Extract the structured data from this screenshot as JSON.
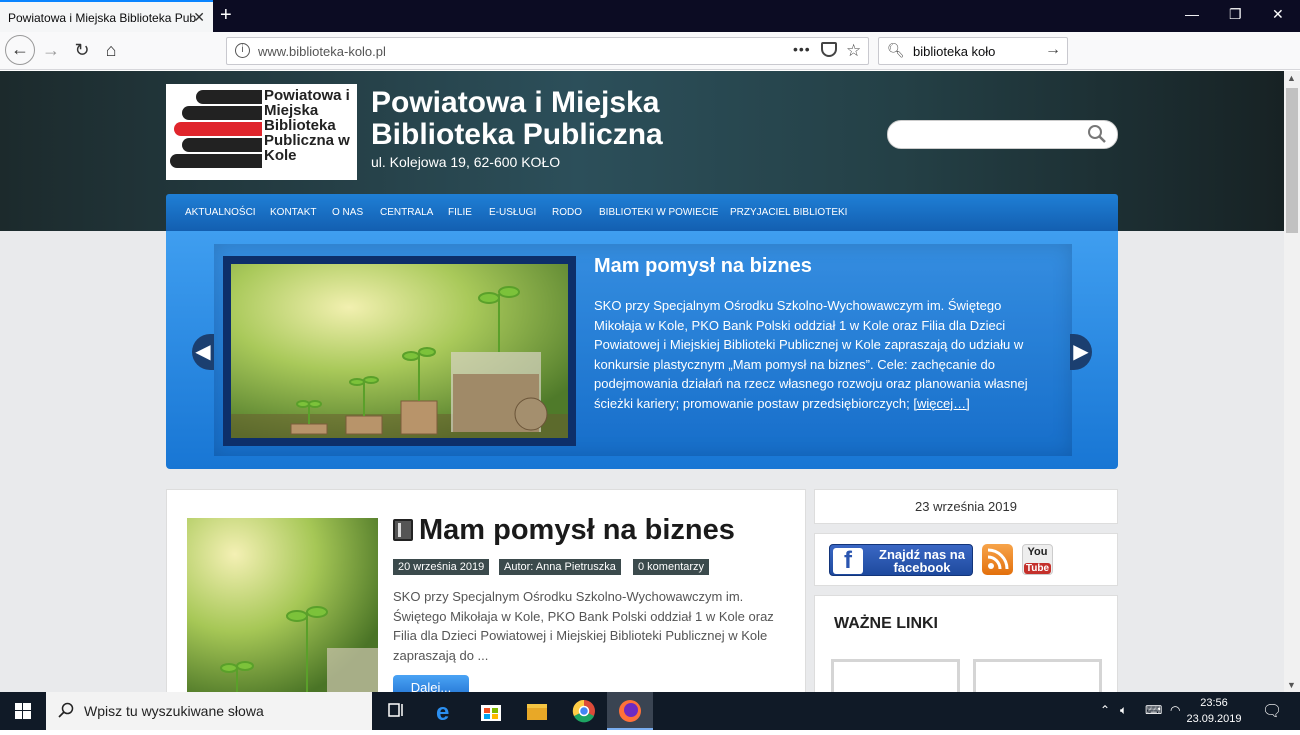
{
  "browser": {
    "tab_title": "Powiatowa i Miejska Biblioteka Pub",
    "url": "www.biblioteka-kolo.pl",
    "search_value": "biblioteka koło"
  },
  "site": {
    "logo_text": "Powiatowa i Miejska Biblioteka Publiczna w Kole",
    "title": "Powiatowa i Miejska Biblioteka Publiczna",
    "address": "ul. Kolejowa 19, 62-600 KOŁO",
    "menu": [
      "AKTUALNOŚCI",
      "KONTAKT",
      "O NAS",
      "CENTRALA",
      "FILIE",
      "E-USŁUGI",
      "RODO",
      "BIBLIOTEKI W POWIECIE",
      "PRZYJACIEL BIBLIOTEKI"
    ]
  },
  "slider": {
    "title": "Mam pomysł na biznes",
    "text": "SKO przy Specjalnym Ośrodku Szkolno-Wychowawczym im. Świętego Mikołaja w Kole, PKO Bank Polski oddział 1 w Kole oraz Filia dla Dzieci Powiatowej i Miejskiej Biblioteki Publicznej w Kole zapraszają do udziału w konkursie plastycznym „Mam pomysł na biznes”. Cele:  zachęcanie do podejmowania działań na rzecz własnego rozwoju oraz planowania własnej ścieżki kariery; promowanie postaw przedsiębiorczych;",
    "more": "[więcej…]"
  },
  "post": {
    "title": "Mam pomysł na biznes",
    "date": "20 września 2019",
    "author": "Autor: Anna Pietruszka",
    "comments": "0 komentarzy",
    "excerpt": "SKO przy Specjalnym Ośrodku Szkolno-Wychowawczym im. Świętego Mikołaja w Kole, PKO Bank Polski oddział 1 w Kole oraz Filia dla Dzieci Powiatowej i Miejskiej Biblioteki Publicznej w Kole zapraszają do ...",
    "button": "Dalej..."
  },
  "sidebar": {
    "date": "23 września 2019",
    "facebook_label": "Znajdź nas na facebook",
    "youtube_you": "You",
    "youtube_tube": "Tube",
    "links_heading": "WAŻNE LINKI"
  },
  "taskbar": {
    "search_placeholder": "Wpisz tu wyszukiwane słowa",
    "time": "23:56",
    "date": "23.09.2019"
  },
  "colors": {
    "menu_blue": "#1a6fc6",
    "slider_blue": "#2a8ae4",
    "header_dark": "#223a40",
    "logo_red": "#e0252c"
  }
}
